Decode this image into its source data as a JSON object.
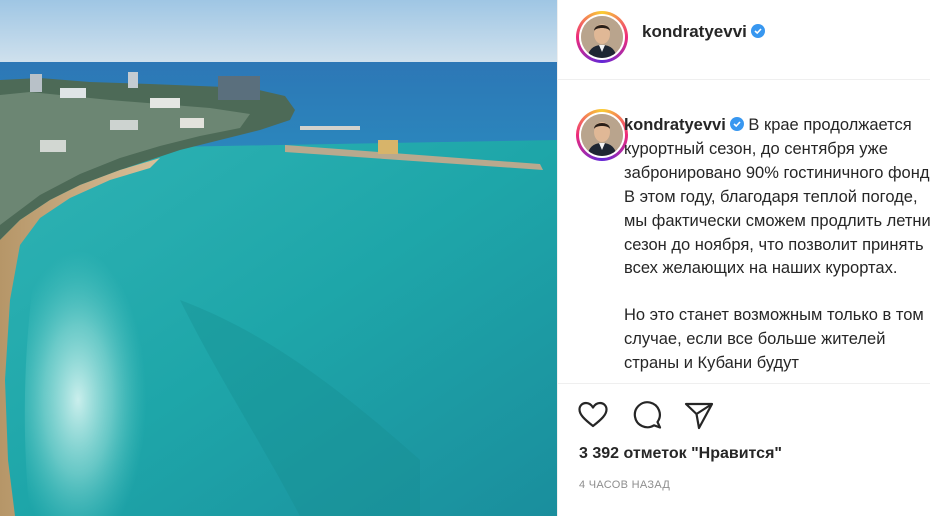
{
  "post": {
    "username": "kondratyevvi",
    "verified": true,
    "caption_p1": "В крае продолжается курортный сезон, до сентября уже забронировано 90% гостиничного фонда. В этом году, благодаря теплой погоде, мы фактически сможем продлить летний сезон до ноября, что позволит принять всех желающих на наших курортах.",
    "caption_p2": "Но это станет возможным только в том случае, если все больше жителей страны и Кубани будут",
    "likes": "3 392 отметок \"Нравится\"",
    "time_ago": "4 ЧАСОВ НАЗАД"
  },
  "icons": {
    "like": "heart-icon",
    "comment": "comment-icon",
    "share": "share-icon",
    "verified": "verified-badge-icon"
  },
  "colors": {
    "text": "#262626",
    "secondary": "#8e8e8e",
    "verified": "#3897f0",
    "border": "#efefef"
  }
}
